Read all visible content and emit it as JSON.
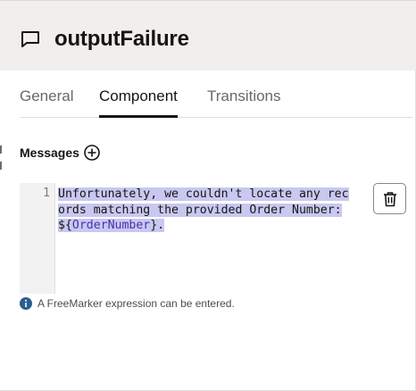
{
  "header": {
    "title": "outputFailure",
    "icon": "speech-bubble-icon"
  },
  "tabs": [
    {
      "label": "General",
      "active": false
    },
    {
      "label": "Component",
      "active": true
    },
    {
      "label": "Transitions",
      "active": false
    }
  ],
  "messages": {
    "label": "Messages",
    "add_icon": "plus-circle-icon",
    "delete_icon": "trash-icon",
    "editor": {
      "line_number": "1",
      "lines": [
        "Unfortunately, we couldn't locate any rec",
        "ords matching the provided Order Number: ",
        {
          "prefix": "${",
          "variable": "OrderNumber",
          "suffix": "}."
        }
      ]
    }
  },
  "hint": {
    "icon": "info-icon",
    "text": "A FreeMarker expression can be entered."
  },
  "colors": {
    "header_bg": "#f1efed",
    "selection": "#c8c8f0",
    "variable": "#4b2fb0",
    "info": "#2c5d8f"
  }
}
